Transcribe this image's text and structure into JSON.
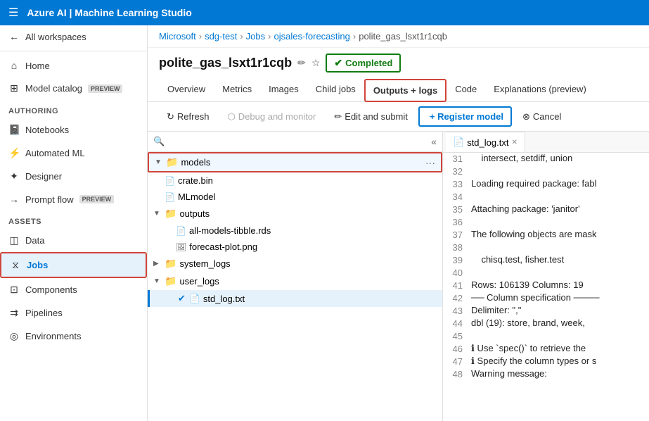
{
  "topBar": {
    "title": "Azure AI | Machine Learning Studio"
  },
  "breadcrumb": {
    "items": [
      "Microsoft",
      "sdg-test",
      "Jobs",
      "ojsales-forecasting",
      "polite_gas_lsxt1r1cqb"
    ]
  },
  "pageTitle": "polite_gas_lsxt1r1cqb",
  "status": {
    "label": "Completed",
    "color": "#107c10"
  },
  "tabs": {
    "items": [
      "Overview",
      "Metrics",
      "Images",
      "Child jobs",
      "Outputs + logs",
      "Code",
      "Explanations (preview)"
    ],
    "active": "Outputs + logs"
  },
  "toolbar": {
    "refresh": "Refresh",
    "debugMonitor": "Debug and monitor",
    "editSubmit": "Edit and submit",
    "registerModel": "+ Register model",
    "cancel": "Cancel"
  },
  "sidebar": {
    "allWorkspaces": "All workspaces",
    "home": "Home",
    "modelCatalog": "Model catalog",
    "authoring": {
      "label": "Authoring",
      "items": [
        "Notebooks",
        "Automated ML",
        "Designer",
        "Prompt flow"
      ]
    },
    "assets": {
      "label": "Assets",
      "items": [
        "Data",
        "Jobs",
        "Components",
        "Pipelines",
        "Environments"
      ]
    }
  },
  "fileTree": {
    "items": [
      {
        "id": "models",
        "label": "models",
        "type": "folder",
        "indent": 0,
        "expanded": true,
        "highlighted": true
      },
      {
        "id": "crate-bin",
        "label": "crate.bin",
        "type": "file",
        "indent": 1
      },
      {
        "id": "mlmodel",
        "label": "MLmodel",
        "type": "file",
        "indent": 1
      },
      {
        "id": "outputs",
        "label": "outputs",
        "type": "folder",
        "indent": 0,
        "expanded": true
      },
      {
        "id": "all-models",
        "label": "all-models-tibble.rds",
        "type": "file",
        "indent": 2
      },
      {
        "id": "forecast-plot",
        "label": "forecast-plot.png",
        "type": "file",
        "indent": 2
      },
      {
        "id": "system-logs",
        "label": "system_logs",
        "type": "folder",
        "indent": 0,
        "expanded": false
      },
      {
        "id": "user-logs",
        "label": "user_logs",
        "type": "folder",
        "indent": 0,
        "expanded": true
      },
      {
        "id": "std-log",
        "label": "std_log.txt",
        "type": "file",
        "indent": 2,
        "active": true
      }
    ]
  },
  "codePane": {
    "filename": "std_log.txt",
    "lines": [
      {
        "num": 31,
        "content": "    intersect, setdiff, union"
      },
      {
        "num": 32,
        "content": ""
      },
      {
        "num": 33,
        "content": "Loading required package: fabl"
      },
      {
        "num": 34,
        "content": ""
      },
      {
        "num": 35,
        "content": "Attaching package: 'janitor'"
      },
      {
        "num": 36,
        "content": ""
      },
      {
        "num": 37,
        "content": "The following objects are mask"
      },
      {
        "num": 38,
        "content": ""
      },
      {
        "num": 39,
        "content": "    chisq.test, fisher.test"
      },
      {
        "num": 40,
        "content": ""
      },
      {
        "num": 41,
        "content": "Rows: 106139 Columns: 19"
      },
      {
        "num": 42,
        "content": "── Column specification ────"
      },
      {
        "num": 43,
        "content": "Delimiter: \",\""
      },
      {
        "num": 44,
        "content": "dbl (19): store, brand, week,"
      },
      {
        "num": 45,
        "content": ""
      },
      {
        "num": 46,
        "content": "ℹ Use `spec()` to retrieve the"
      },
      {
        "num": 47,
        "content": "ℹ Specify the column types or s"
      },
      {
        "num": 48,
        "content": "Warning message:"
      }
    ]
  }
}
